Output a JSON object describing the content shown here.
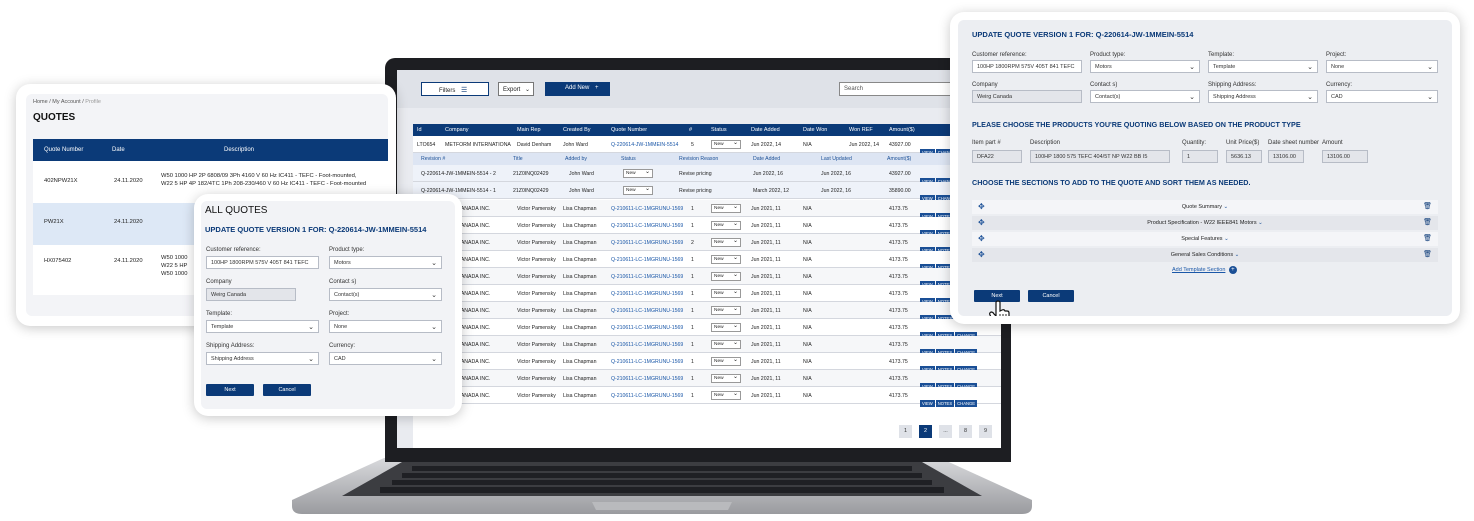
{
  "profile": {
    "breadcrumb_home": "Home",
    "breadcrumb_account": "My Account",
    "breadcrumb_current": "Profile",
    "title": "QUOTES",
    "columns": [
      "Quote Number",
      "Date",
      "Description"
    ],
    "rows": [
      {
        "number": "402NPW21X",
        "date": "24.11.2020",
        "desc1": "W50 1000 HP 2P 6808/09 3Ph 4160 V 60 Hz IC411 - TEFC - Foot-mounted,",
        "desc2": "W22 5 HP 4P 182/4TC 1Ph 208-230/460 V 60 Hz IC411 - TEFC - Foot-mounted"
      },
      {
        "number": "PW21X",
        "date": "24.11.2020",
        "desc1": "",
        "desc2": ""
      },
      {
        "number": "HX075402",
        "date": "24.11.2020",
        "desc1": "W50 1000",
        "desc2": "W22 5 HP",
        "desc3": "W50 1000"
      }
    ]
  },
  "all_quotes": {
    "title": "ALL QUOTES",
    "subtitle": "UPDATE QUOTE VERSION 1 FOR:  Q-220614-JW-1MMEIN-5514",
    "customer_ref_label": "Customer reference:",
    "customer_ref_value": "100HP 1800RPM 575V 405T 841 TEFC",
    "product_type_label": "Product type:",
    "product_type_value": "Motors",
    "company_label": "Company",
    "company_value": "Weirg Canada",
    "contacts_label": "Contact s)",
    "contacts_value": "Contact(s)",
    "template_label": "Template:",
    "template_value": "Template",
    "project_label": "Project:",
    "project_value": "None",
    "shipping_label": "Shipping Address:",
    "shipping_value": "Shipping Address",
    "currency_label": "Currency:",
    "currency_value": "CAD",
    "next": "Next",
    "cancel": "Cancel"
  },
  "laptop": {
    "filters": "Filters",
    "export": "Export",
    "add_new": "Add New",
    "search_placeholder": "Search",
    "columns": [
      "Id",
      "Company",
      "Main Rep",
      "Created By",
      "Quote Number",
      "#",
      "Status",
      "Date Added",
      "Date Won",
      "Won REF",
      "Amount($)"
    ],
    "first_row": {
      "id": "LTO654",
      "company": "METFORM INTERNATIONA",
      "rep": "David Denham",
      "by": "John Ward",
      "quote": "Q-220614-JW-1MMEIN-5514",
      "num": "5",
      "status": "New",
      "date": "Jun 2022, 14",
      "won": "N/A",
      "wonref": "Jun 2022, 14",
      "amount": "43927.00"
    },
    "rev_columns": [
      "Revision #",
      "Title",
      "Added by",
      "Status",
      "Revision Reason",
      "Date Added",
      "Last Updated",
      "Amount($)"
    ],
    "revisions": [
      {
        "rev": "Q-220614-JW-1MMEIN-5514 - 2",
        "title": "21Z0INQ02429",
        "by": "John Ward",
        "status": "New",
        "reason": "Revise pricing",
        "date": "Jun 2022, 16",
        "updated": "Jun 2022, 16",
        "amount": "43927.00"
      },
      {
        "rev": "Q-220614-JW-1MMEIN-5514 - 1",
        "title": "21Z0INQ02429",
        "by": "John Ward",
        "status": "New",
        "reason": "Revise pricing",
        "date": "March 2022, 12",
        "updated": "Jun 2022, 16",
        "amount": "35890.00"
      }
    ],
    "rows": [
      {
        "company": "FOS CANADA INC.",
        "rep": "Victor Pamensky",
        "by": "Lisa Chapman",
        "quote": "Q-210611-LC-1MGRUNU-1569",
        "num": "1",
        "status": "New",
        "date": "Jun 2021, 11",
        "won": "N/A",
        "amount": "4173.75"
      },
      {
        "company": "FOS CANADA INC.",
        "rep": "Victor Pamensky",
        "by": "Lisa Chapman",
        "quote": "Q-210611-LC-1MGRUNU-1569",
        "num": "1",
        "status": "New",
        "date": "Jun 2021, 11",
        "won": "N/A",
        "amount": "4173.75"
      },
      {
        "company": "FOS CANADA INC.",
        "rep": "Victor Pamensky",
        "by": "Lisa Chapman",
        "quote": "Q-210611-LC-1MGRUNU-1569",
        "num": "2",
        "status": "New",
        "date": "Jun 2021, 11",
        "won": "N/A",
        "amount": "4173.75"
      },
      {
        "company": "FOS CANADA INC.",
        "rep": "Victor Pamensky",
        "by": "Lisa Chapman",
        "quote": "Q-210611-LC-1MGRUNU-1569",
        "num": "1",
        "status": "New",
        "date": "Jun 2021, 11",
        "won": "N/A",
        "amount": "4173.75"
      },
      {
        "company": "FOS CANADA INC.",
        "rep": "Victor Pamensky",
        "by": "Lisa Chapman",
        "quote": "Q-210611-LC-1MGRUNU-1569",
        "num": "1",
        "status": "New",
        "date": "Jun 2021, 11",
        "won": "N/A",
        "amount": "4173.75"
      },
      {
        "company": "FOS CANADA INC.",
        "rep": "Victor Pamensky",
        "by": "Lisa Chapman",
        "quote": "Q-210611-LC-1MGRUNU-1569",
        "num": "1",
        "status": "New",
        "date": "Jun 2021, 11",
        "won": "N/A",
        "amount": "4173.75"
      },
      {
        "company": "FOS CANADA INC.",
        "rep": "Victor Pamensky",
        "by": "Lisa Chapman",
        "quote": "Q-210611-LC-1MGRUNU-1569",
        "num": "1",
        "status": "New",
        "date": "Jun 2021, 11",
        "won": "N/A",
        "amount": "4173.75"
      },
      {
        "company": "FOS CANADA INC.",
        "rep": "Victor Pamensky",
        "by": "Lisa Chapman",
        "quote": "Q-210611-LC-1MGRUNU-1569",
        "num": "1",
        "status": "New",
        "date": "Jun 2021, 11",
        "won": "N/A",
        "amount": "4173.75"
      },
      {
        "company": "FOS CANADA INC.",
        "rep": "Victor Pamensky",
        "by": "Lisa Chapman",
        "quote": "Q-210611-LC-1MGRUNU-1569",
        "num": "1",
        "status": "New",
        "date": "Jun 2021, 11",
        "won": "N/A",
        "amount": "4173.75"
      },
      {
        "company": "FOS CANADA INC.",
        "rep": "Victor Pamensky",
        "by": "Lisa Chapman",
        "quote": "Q-210611-LC-1MGRUNU-1569",
        "num": "1",
        "status": "New",
        "date": "Jun 2021, 11",
        "won": "N/A",
        "amount": "4173.75"
      },
      {
        "company": "FOS CANADA INC.",
        "rep": "Victor Pamensky",
        "by": "Lisa Chapman",
        "quote": "Q-210611-LC-1MGRUNU-1569",
        "num": "1",
        "status": "New",
        "date": "Jun 2021, 11",
        "won": "N/A",
        "amount": "4173.75"
      },
      {
        "company": "FOS CANADA INC.",
        "rep": "Victor Pamensky",
        "by": "Lisa Chapman",
        "quote": "Q-210611-LC-1MGRUNU-1569",
        "num": "1",
        "status": "New",
        "date": "Jun 2021, 11",
        "won": "N/A",
        "amount": "4173.75"
      }
    ],
    "view": "VIEW",
    "notes": "NOTES",
    "change": "CHANGE",
    "pages": [
      "1",
      "2",
      "...",
      "8",
      "9"
    ]
  },
  "update": {
    "title": "UPDATE QUOTE VERSION 1 FOR:  Q-220614-JW-1MMEIN-5514",
    "customer_ref_label": "Customer reference:",
    "customer_ref_value": "100HP 1800RPM 575V 405T 841 TEFC",
    "product_type_label": "Product type:",
    "product_type_value": "Motors",
    "template_label": "Template:",
    "template_value": "Template",
    "project_label": "Project:",
    "project_value": "None",
    "company_label": "Company",
    "company_value": "Weirg Canada",
    "contacts_label": "Contact s)",
    "contacts_value": "Contact(s)",
    "shipping_label": "Shipping Address:",
    "shipping_value": "Shipping Address",
    "currency_label": "Currency:",
    "currency_value": "CAD",
    "products_heading": "PLEASE CHOOSE THE PRODUCTS YOU'RE QUOTING BELOW BASED ON THE PRODUCT TYPE",
    "item_label": "Item part #",
    "item_value": "DFA22",
    "desc_label": "Description",
    "desc_value": "100HP 1800 575 TEFC 404/5T NP W22 BB I5",
    "qty_label": "Quantity:",
    "qty_value": "1",
    "unit_label": "Unit Price($)",
    "unit_value": "5636.13",
    "date_label": "Date sheet number",
    "date_value": "13106.00",
    "amount_label": "Amount",
    "amount_value": "13106.00",
    "sections_heading": "CHOOSE THE SECTIONS TO ADD TO THE QUOTE AND SORT THEM AS NEEDED.",
    "sections": [
      "Quote Summary",
      "Product Specification - W22 IEEE841 Motors",
      "Special Features",
      "General Sales Conditions"
    ],
    "add_section": "Add Template Section",
    "next": "Next",
    "cancel": "Cancel"
  }
}
